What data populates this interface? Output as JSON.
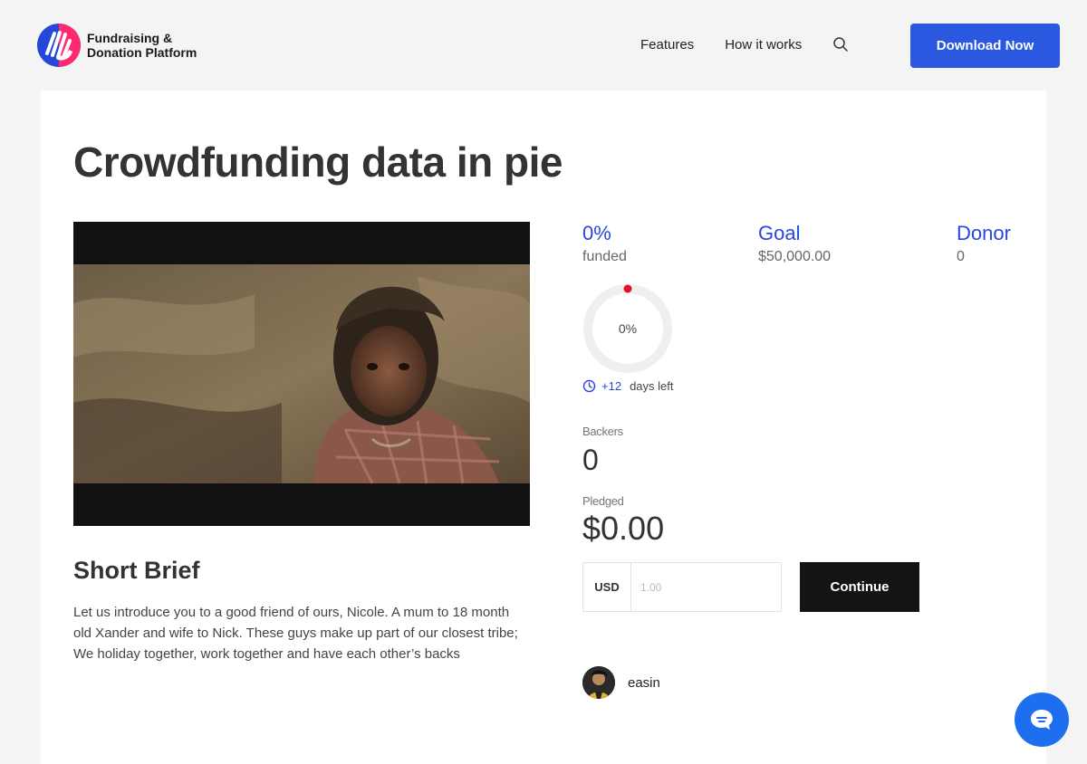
{
  "header": {
    "logo_line1": "Fundraising &",
    "logo_line2": "Donation Platform",
    "nav": [
      "Features",
      "How it works"
    ],
    "download_label": "Download Now"
  },
  "campaign": {
    "title": "Crowdfunding data in pie",
    "funded": {
      "value": "0%",
      "label": "funded"
    },
    "goal": {
      "value": "Goal",
      "label": "$50,000.00"
    },
    "donor": {
      "value": "Donor",
      "label": "0"
    },
    "progress_label": "0%",
    "progress": 0,
    "days_left_num": "+12",
    "days_left_label": "days left",
    "backers_label": "Backers",
    "backers_value": "0",
    "pledged_label": "Pledged",
    "pledged_value": "$0.00",
    "currency": "USD",
    "amount_placeholder": "1.00",
    "continue_label": "Continue",
    "author": "easin"
  },
  "brief": {
    "title": "Short Brief",
    "text": "Let us introduce you to a good friend of ours, Nicole. A mum to 18 month old Xander and wife to Nick. These guys make up part of our closest tribe; We holiday together, work together and have each other’s backs"
  },
  "colors": {
    "accent": "#2a58e0",
    "stat_blue": "#2a45e0",
    "progress_dot": "#e0102a",
    "dark_button": "#141414",
    "chat": "#1e6ff0"
  },
  "icons": {
    "logo": "hands-logo-icon",
    "search": "search-icon",
    "clock": "clock-icon",
    "chat": "chat-icon"
  }
}
